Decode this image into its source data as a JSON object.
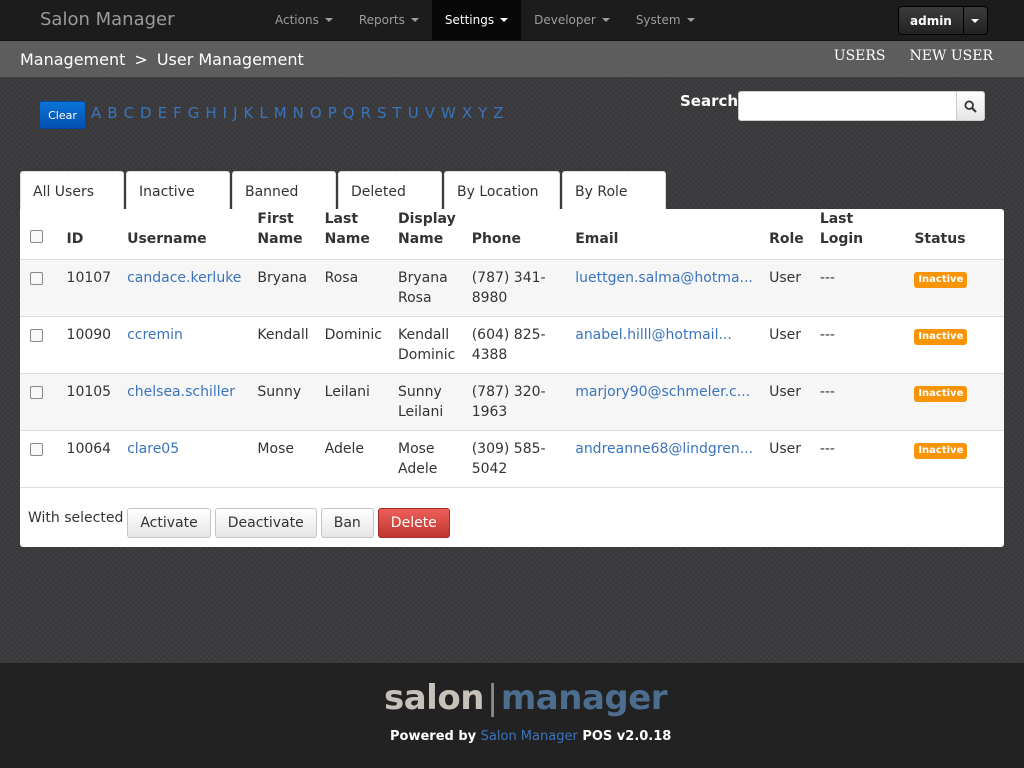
{
  "app": {
    "brand": "Salon Manager"
  },
  "nav": {
    "items": [
      {
        "label": "Actions"
      },
      {
        "label": "Reports"
      },
      {
        "label": "Settings"
      },
      {
        "label": "Developer"
      },
      {
        "label": "System"
      }
    ],
    "user": "admin"
  },
  "subheader": {
    "crumb_root": "Management",
    "crumb_sep": ">",
    "crumb_current": "User Management",
    "link_users": "USERS",
    "link_new_user": "NEW USER"
  },
  "alphabet": {
    "clear_label": "Clear",
    "letters": [
      "A",
      "B",
      "C",
      "D",
      "E",
      "F",
      "G",
      "H",
      "I",
      "J",
      "K",
      "L",
      "M",
      "N",
      "O",
      "P",
      "Q",
      "R",
      "S",
      "T",
      "U",
      "V",
      "W",
      "X",
      "Y",
      "Z"
    ]
  },
  "search": {
    "label": "Search:",
    "value": ""
  },
  "tabs": [
    {
      "label": "All Users"
    },
    {
      "label": "Inactive"
    },
    {
      "label": "Banned"
    },
    {
      "label": "Deleted"
    },
    {
      "label": "By Location"
    },
    {
      "label": "By Role"
    }
  ],
  "table": {
    "headers": {
      "id": "ID",
      "username": "Username",
      "first_name_1": "First",
      "first_name_2": "Name",
      "last_name_1": "Last",
      "last_name_2": "Name",
      "display_name_1": "Display",
      "display_name_2": "Name",
      "phone": "Phone",
      "email": "Email",
      "role": "Role",
      "last_login": "Last Login",
      "status": "Status"
    },
    "rows": [
      {
        "id": "10107",
        "username": "candace.kerluke",
        "first": "Bryana",
        "last": "Rosa",
        "display_1": "Bryana",
        "display_2": "Rosa",
        "phone": "(787) 341-8980",
        "email": "luettgen.salma@hotma...",
        "role": "User",
        "last_login": "---",
        "status": "Inactive"
      },
      {
        "id": "10090",
        "username": "ccremin",
        "first": "Kendall",
        "last": "Dominic",
        "display_1": "Kendall",
        "display_2": "Dominic",
        "phone": "(604) 825-4388",
        "email": "anabel.hilll@hotmail...",
        "role": "User",
        "last_login": "---",
        "status": "Inactive"
      },
      {
        "id": "10105",
        "username": "chelsea.schiller",
        "first": "Sunny",
        "last": "Leilani",
        "display_1": "Sunny",
        "display_2": "Leilani",
        "phone": "(787) 320-1963",
        "email": "marjory90@schmeler.c...",
        "role": "User",
        "last_login": "---",
        "status": "Inactive"
      },
      {
        "id": "10064",
        "username": "clare05",
        "first": "Mose",
        "last": "Adele",
        "display_1": "Mose",
        "display_2": "Adele",
        "phone": "(309) 585-5042",
        "email": "andreanne68@lindgren...",
        "role": "User",
        "last_login": "---",
        "status": "Inactive"
      }
    ]
  },
  "bulk": {
    "label": "With selected",
    "activate": "Activate",
    "deactivate": "Deactivate",
    "ban": "Ban",
    "delete": "Delete"
  },
  "footer": {
    "logo_a": "salon",
    "logo_sep": "|",
    "logo_b": "manager",
    "powered_prefix": "Powered by",
    "powered_name": "Salon Manager",
    "powered_suffix": "POS v2.0.18"
  },
  "colors": {
    "accent": "#3a74bd",
    "badge_inactive": "#f89406",
    "danger": "#bd362f",
    "primary": "#0350b0"
  }
}
